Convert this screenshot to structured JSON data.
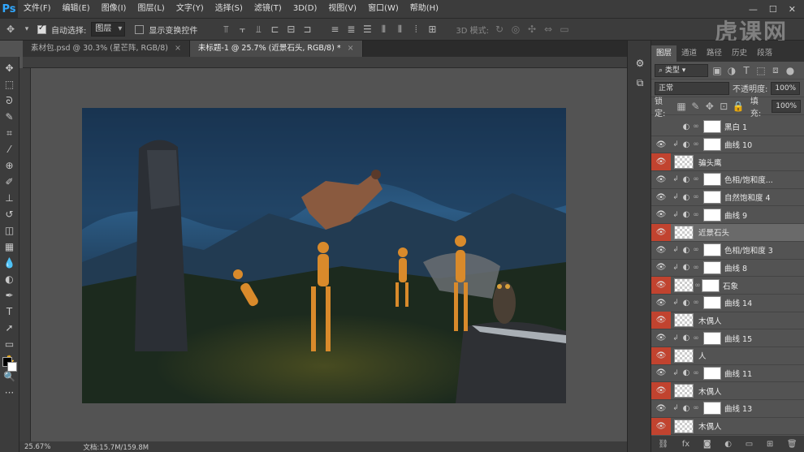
{
  "app": {
    "logo": "Ps"
  },
  "menu": [
    "文件(F)",
    "编辑(E)",
    "图像(I)",
    "图层(L)",
    "文字(Y)",
    "选择(S)",
    "滤镜(T)",
    "3D(D)",
    "视图(V)",
    "窗口(W)",
    "帮助(H)"
  ],
  "options": {
    "auto_select_label": "自动选择:",
    "auto_select_value": "图层",
    "show_transform_label": "显示变换控件",
    "mode3d_label": "3D 模式:"
  },
  "watermark": "虎课网",
  "tabs": [
    {
      "label": "素材包.psd @ 30.3% (星芒阵, RGB/8)",
      "close": "×"
    },
    {
      "label": "未标题-1 @ 25.7% (近景石头, RGB/8) *",
      "close": "×"
    }
  ],
  "status": {
    "zoom": "25.67%",
    "doc": "文档:15.7M/159.8M"
  },
  "panel": {
    "tabs": [
      "图层",
      "通道",
      "路径",
      "历史",
      "段落"
    ],
    "filter_kind": "类型",
    "blend_mode": "正常",
    "opacity_label": "不透明度:",
    "opacity_value": "100%",
    "lock_label": "锁定:",
    "fill_label": "填充:",
    "fill_value": "100%"
  },
  "layers": [
    {
      "name": "黑白 1",
      "eye": "none",
      "type": "adj",
      "clip": false
    },
    {
      "name": "曲线 10",
      "eye": "normal",
      "type": "adj",
      "clip": true
    },
    {
      "name": "骗头鹰",
      "eye": "red",
      "type": "pixel",
      "clip": false
    },
    {
      "name": "色相/饱和度...",
      "eye": "normal",
      "type": "adj",
      "clip": true
    },
    {
      "name": "自然饱和度 4",
      "eye": "normal",
      "type": "adj",
      "clip": true
    },
    {
      "name": "曲线 9",
      "eye": "normal",
      "type": "adj",
      "clip": true
    },
    {
      "name": "近景石头",
      "eye": "red",
      "type": "pixel",
      "clip": false,
      "selected": true
    },
    {
      "name": "色相/饱和度 3",
      "eye": "normal",
      "type": "adj",
      "clip": true
    },
    {
      "name": "曲线 8",
      "eye": "normal",
      "type": "adj",
      "clip": true
    },
    {
      "name": "石象",
      "eye": "red",
      "type": "masked",
      "clip": false
    },
    {
      "name": "曲线 14",
      "eye": "normal",
      "type": "adj",
      "clip": true
    },
    {
      "name": "木偶人",
      "eye": "red",
      "type": "pixel",
      "clip": false
    },
    {
      "name": "曲线 15",
      "eye": "normal",
      "type": "adj",
      "clip": true
    },
    {
      "name": "人",
      "eye": "red",
      "type": "pixel",
      "clip": false
    },
    {
      "name": "曲线 11",
      "eye": "normal",
      "type": "adj",
      "clip": true
    },
    {
      "name": "木偶人",
      "eye": "red",
      "type": "pixel",
      "clip": false
    },
    {
      "name": "曲线 13",
      "eye": "normal",
      "type": "adj",
      "clip": true
    },
    {
      "name": "木偶人",
      "eye": "red",
      "type": "pixel",
      "clip": false
    }
  ]
}
